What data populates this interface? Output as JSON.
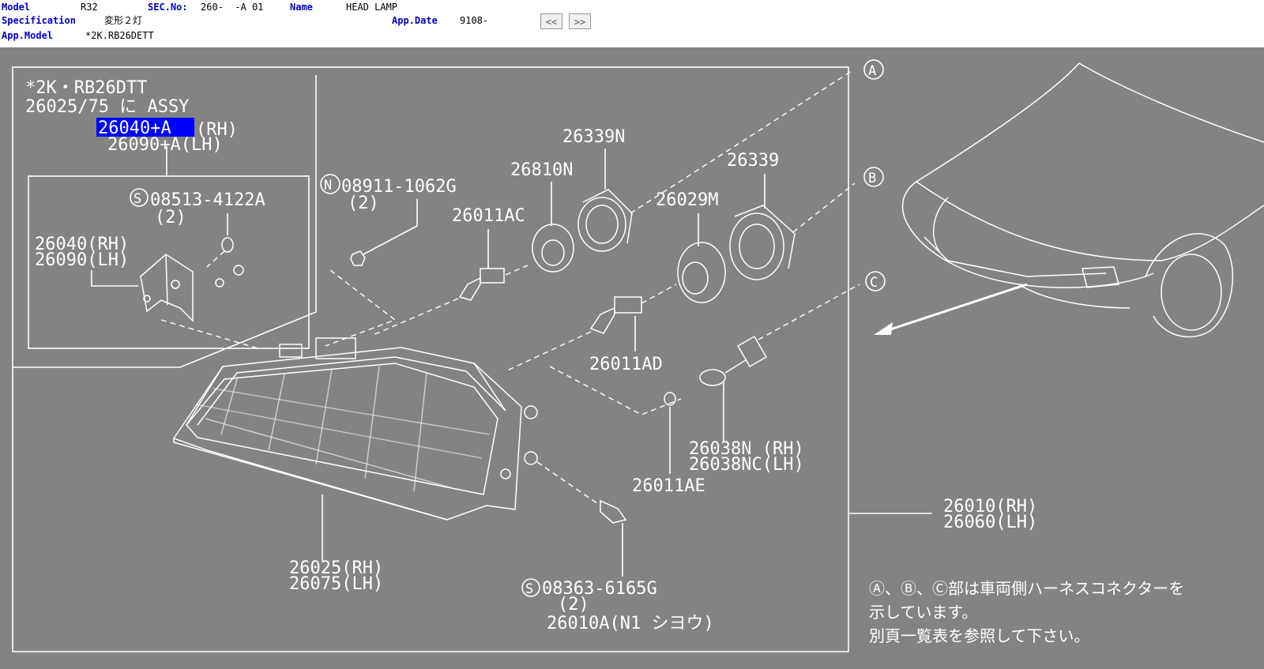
{
  "header": {
    "model_label": "Model",
    "model_value": "R32",
    "sec_label": "SEC.No:",
    "sec_value": "260-  -A 01",
    "name_label": "Name",
    "name_value": "HEAD LAMP",
    "spec_label": "Specification",
    "spec_value": "変形２灯",
    "appdate_label": "App.Date",
    "appdate_value": "9108-",
    "appmodel_label": "App.Model",
    "appmodel_value": "*2K.RB26DETT",
    "prev_button": "<<",
    "next_button": ">>"
  },
  "diagram": {
    "inset_title_1": "*2K・RB26DTT",
    "inset_title_2": "26025/75 に ASSY",
    "highlighted_part": "26040+A",
    "highlighted_part_side": "(RH)",
    "part_26090A": "26090+A(LH)",
    "bolt_08513": "08513-4122A",
    "bolt_08513_qty": "(2)",
    "bracket_rh": "26040(RH)",
    "bracket_lh": "26090(LH)",
    "nut_08911": "08911-1062G",
    "nut_08911_qty": "(2)",
    "part_26011AC": "26011AC",
    "part_26810N": "26810N",
    "part_26339N": "26339N",
    "part_26339": "26339",
    "part_26029M": "26029M",
    "part_26011AD": "26011AD",
    "part_26038N": "26038N (RH)",
    "part_26038NC": "26038NC(LH)",
    "part_26011AE": "26011AE",
    "part_26010": "26010(RH)",
    "part_26060": "26060(LH)",
    "part_26025": "26025(RH)",
    "part_26075": "26075(LH)",
    "bolt_08363": "08363-6165G",
    "bolt_08363_qty": "(2)",
    "part_26010A": "26010A(N1 シヨウ)",
    "callout_a": "A",
    "callout_b": "B",
    "callout_c": "C",
    "circle_n": "N",
    "circle_s": "S",
    "note_line_1": "Ⓐ、Ⓑ、Ⓒ部は車両側ハーネスコネクターを",
    "note_line_2": "示しています。",
    "note_line_3": "別頁一覧表を参照して下さい。"
  },
  "colors": {
    "diagram_bg": "#838383",
    "line": "#ffffff",
    "label_blue": "#0000c8",
    "highlight": "#0000ff"
  }
}
